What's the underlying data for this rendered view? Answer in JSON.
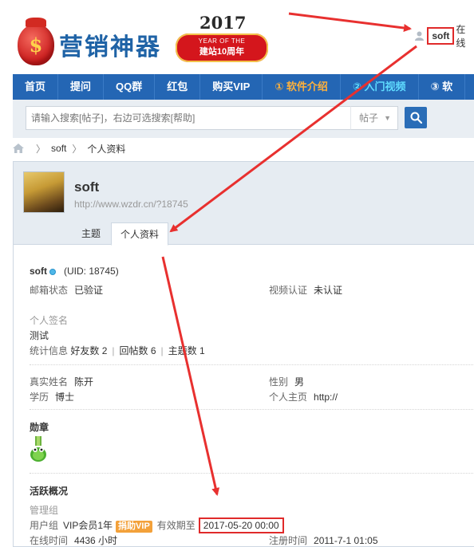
{
  "header": {
    "logo_symbol": "$",
    "logo_text": "营销神器",
    "anniversary": {
      "year": "2017",
      "line1": "YEAR OF THE",
      "line2": "建站10周年"
    },
    "user": {
      "icon": "user-icon",
      "name": "soft",
      "status": "在线"
    }
  },
  "nav": {
    "items": [
      {
        "label": "首页",
        "color": "#ffffff"
      },
      {
        "label": "提问",
        "color": "#ffffff"
      },
      {
        "label": "QQ群",
        "color": "#ffffff"
      },
      {
        "label": "红包",
        "color": "#ffffff"
      },
      {
        "label": "购买VIP",
        "color": "#ffffff"
      },
      {
        "label": "① 软件介绍",
        "color": "#ffb13b"
      },
      {
        "label": "② 入门视频",
        "color": "#5fdcff"
      },
      {
        "label": "③ 软",
        "color": "#ffffff"
      }
    ]
  },
  "search": {
    "placeholder": "请输入搜索[帖子]，右边可选搜索[帮助]",
    "scope": "帖子",
    "button_icon": "search-icon"
  },
  "breadcrumb": {
    "home_icon": "home-icon",
    "items": [
      "soft",
      "个人资料"
    ]
  },
  "profile": {
    "name": "soft",
    "url": "http://www.wzdr.cn/?18745",
    "tabs": [
      "主题",
      "个人资料"
    ],
    "active_tab": "个人资料",
    "username": "soft",
    "uid": "(UID: 18745)",
    "email_status": {
      "label": "邮箱状态",
      "value": "已验证"
    },
    "video_auth": {
      "label": "视频认证",
      "value": "未认证"
    },
    "signature_label": "个人签名",
    "signature": "测试",
    "stats": {
      "label": "统计信息",
      "friends": "好友数 2",
      "replies": "回帖数 6",
      "threads": "主题数 1"
    },
    "real_name": {
      "label": "真实姓名",
      "value": "陈开"
    },
    "gender": {
      "label": "性别",
      "value": "男"
    },
    "education": {
      "label": "学历",
      "value": "博士"
    },
    "homepage": {
      "label": "个人主页",
      "value": "http://"
    },
    "medal_title": "勋章",
    "activity_title": "活跃概况",
    "admin_group_label": "管理组",
    "user_group": {
      "label": "用户组",
      "value": "VIP会员1年",
      "badge": "捐助VIP",
      "expire_label": "有效期至",
      "expire_value": "2017-05-20 00:00"
    },
    "online_time": {
      "label": "在线时间",
      "value": "4436 小时"
    },
    "register_time": {
      "label": "注册时间",
      "value": "2011-7-1 01:05"
    }
  },
  "colors": {
    "nav_bg": "#2466b4",
    "accent_red": "#e02a2a",
    "link_grey": "#999999"
  }
}
